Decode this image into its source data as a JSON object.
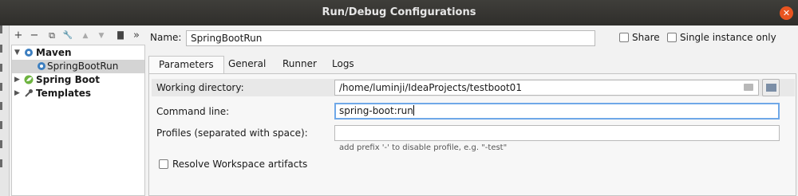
{
  "window": {
    "title": "Run/Debug Configurations",
    "close_glyph": "✕"
  },
  "toolbar": {
    "icons": [
      {
        "name": "add-icon",
        "glyph": "+"
      },
      {
        "name": "remove-icon",
        "glyph": "−"
      },
      {
        "name": "copy-icon",
        "glyph": "⧉"
      },
      {
        "name": "wrench-icon",
        "glyph": "🔧"
      },
      {
        "name": "move-up-icon",
        "glyph": "▲"
      },
      {
        "name": "move-down-icon",
        "glyph": "▼"
      },
      {
        "name": "folder-icon",
        "glyph": "▇"
      },
      {
        "name": "more-icon",
        "glyph": "»"
      }
    ]
  },
  "tree": {
    "items": [
      {
        "label": "Maven",
        "icon": "gear-icon",
        "expanded": true
      },
      {
        "label": "SpringBootRun",
        "icon": "gear-icon",
        "selected": true
      },
      {
        "label": "Spring Boot",
        "icon": "spring-leaf-icon",
        "expanded": false
      },
      {
        "label": "Templates",
        "icon": "wrench-icon",
        "expanded": false
      }
    ]
  },
  "name_field": {
    "label": "Name:",
    "value": "SpringBootRun"
  },
  "share": {
    "label": "Share",
    "checked": false
  },
  "single_instance": {
    "label": "Single instance only",
    "checked": false
  },
  "tabs": [
    "Parameters",
    "General",
    "Runner",
    "Logs"
  ],
  "active_tab": "Parameters",
  "form": {
    "working_directory": {
      "label": "Working directory:",
      "value": "/home/luminji/IdeaProjects/testboot01"
    },
    "command_line": {
      "label": "Command line:",
      "value": "spring-boot:run"
    },
    "profiles": {
      "label": "Profiles (separated with space):",
      "value": "",
      "hint": "add prefix '-' to disable profile, e.g. \"-test\""
    },
    "resolve_workspace": {
      "label": "Resolve Workspace artifacts",
      "checked": false
    }
  },
  "colors": {
    "titlebar": "#35342f",
    "close": "#e95420",
    "focus": "#6fa8e8",
    "maven_icon": "#3d7fc0",
    "spring_icon": "#6db33f"
  }
}
